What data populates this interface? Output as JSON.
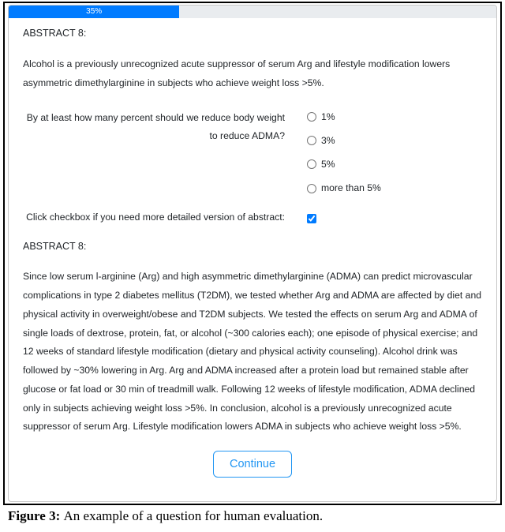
{
  "progress": {
    "percent_width": "35%",
    "percent_label": "35%"
  },
  "abstract1": {
    "title": "ABSTRACT 8:",
    "text": "Alcohol is a previously unrecognized acute suppressor of serum Arg and lifestyle modification lowers asymmetric dimethylarginine in subjects who achieve weight loss >5%."
  },
  "question": {
    "label": "By at least how many percent should we reduce body weight to reduce ADMA?",
    "options": [
      "1%",
      "3%",
      "5%",
      "more than 5%"
    ]
  },
  "checkbox": {
    "label": "Click checkbox if you need more detailed version of abstract:",
    "checked": true
  },
  "abstract2": {
    "title": "ABSTRACT 8:",
    "text": "Since low serum l-arginine (Arg) and high asymmetric dimethylarginine (ADMA) can predict microvascular complications in type 2 diabetes mellitus (T2DM), we tested whether Arg and ADMA are affected by diet and physical activity in overweight/obese and T2DM subjects. We tested the effects on serum Arg and ADMA of single loads of dextrose, protein, fat, or alcohol (~300 calories each); one episode of physical exercise; and 12 weeks of standard lifestyle modification (dietary and physical activity counseling). Alcohol drink was followed by ~30% lowering in Arg. Arg and ADMA increased after a protein load but remained stable after glucose or fat load or 30 min of treadmill walk. Following 12 weeks of lifestyle modification, ADMA declined only in subjects achieving weight loss >5%. In conclusion, alcohol is a previously unrecognized acute suppressor of serum Arg. Lifestyle modification lowers ADMA in subjects who achieve weight loss >5%."
  },
  "continue_label": "Continue",
  "caption": {
    "prefix": "Figure 3: ",
    "text": "An example of a question for human evaluation."
  }
}
